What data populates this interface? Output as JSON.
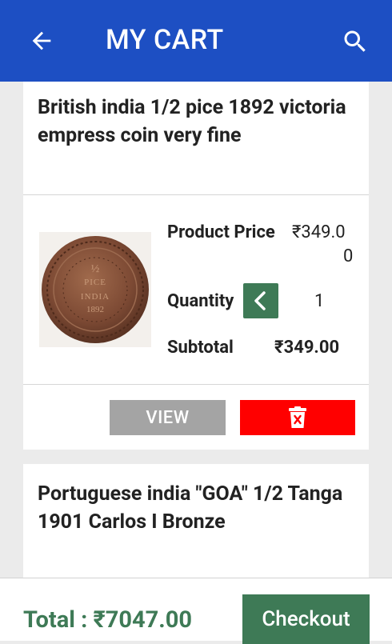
{
  "header": {
    "title": "MY CART",
    "back_icon": "arrow-left-icon",
    "search_icon": "search-icon",
    "background_color": "#1d4fc3"
  },
  "cart_items": [
    {
      "title": "British india 1/2 pice 1892 victoria empress coin very fine",
      "image_icon": "coin-thumbnail",
      "price_label": "Product Price",
      "price_value": "₹349.0",
      "price_value_wrap": "0",
      "quantity_label": "Quantity",
      "quantity_value": "1",
      "subtotal_label": "Subtotal",
      "subtotal_value": "₹349.00",
      "view_label": "VIEW",
      "delete_icon": "trash-icon"
    },
    {
      "title": "Portuguese india \"GOA\" 1/2 Tanga 1901 Carlos I Bronze"
    }
  ],
  "footer": {
    "total_text": "Total : ₹7047.00",
    "checkout_label": "Checkout",
    "accent_color": "#3e7a56"
  }
}
